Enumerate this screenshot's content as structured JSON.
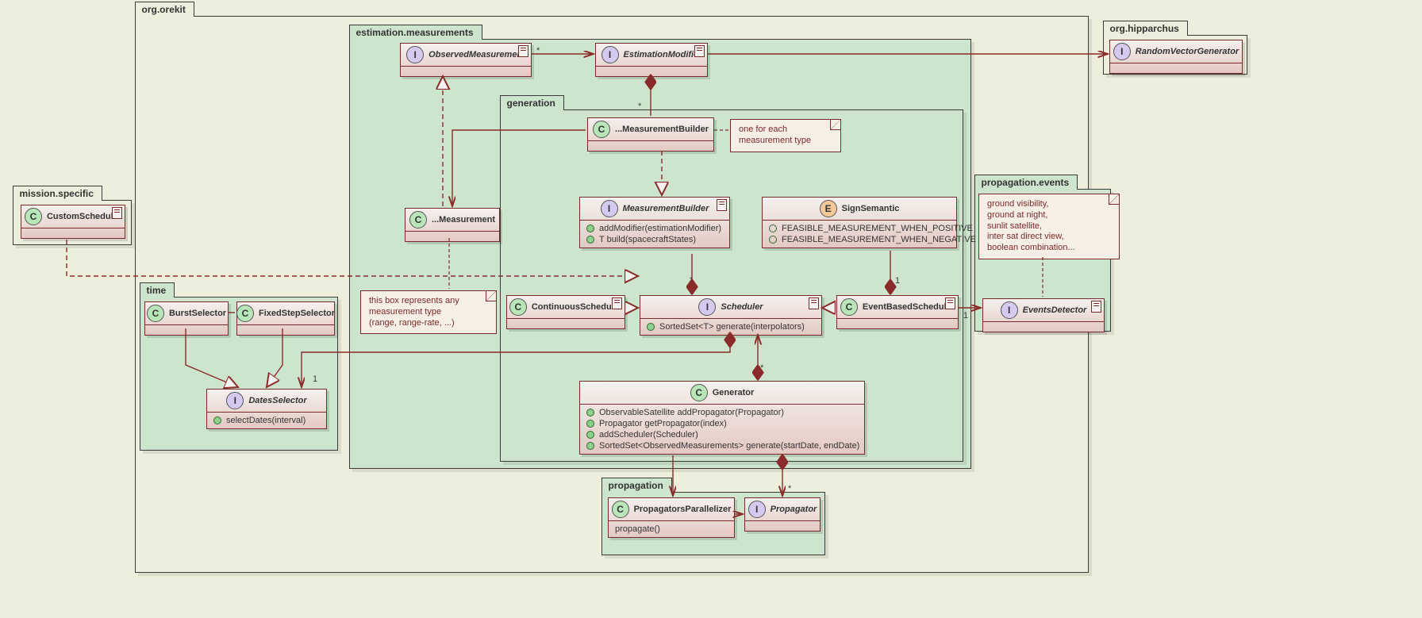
{
  "packages": {
    "mission_specific": "mission.specific",
    "org_orekit": "org.orekit",
    "time": "time",
    "estimation_measurements": "estimation.measurements",
    "generation": "generation",
    "propagation": "propagation",
    "propagation_events": "propagation.events",
    "org_hipparchus": "org.hipparchus"
  },
  "classes": {
    "custom_scheduler": "CustomScheduler",
    "burst_selector": "BurstSelector",
    "fixed_step_selector": "FixedStepSelector",
    "dates_selector": "DatesSelector",
    "dates_selector_m1": "selectDates(interval)",
    "observed_measurement": "ObservedMeasurement",
    "estimation_modifier": "EstimationModifier",
    "measurement": "...Measurement",
    "measurement_builder_cls": "...MeasurementBuilder",
    "measurement_builder_iface": "MeasurementBuilder",
    "mb_m1": "addModifier(estimationModifier)",
    "mb_m2": "T build(spacecraftStates)",
    "sign_semantic": "SignSemantic",
    "ss_m1": "FEASIBLE_MEASUREMENT_WHEN_POSITIVE",
    "ss_m2": "FEASIBLE_MEASUREMENT_WHEN_NEGATIVE",
    "continuous_scheduler": "ContinuousScheduler",
    "scheduler": "Scheduler",
    "scheduler_m1": "SortedSet<T> generate(interpolators)",
    "event_based_scheduler": "EventBasedScheduler",
    "generator": "Generator",
    "gen_m1": "ObservableSatellite addPropagator(Propagator)",
    "gen_m2": "Propagator getPropagator(index)",
    "gen_m3": "addScheduler(Scheduler)",
    "gen_m4": "SortedSet<ObservedMeasurements> generate(startDate, endDate)",
    "propagators_parallelizer": "PropagatorsParallelizer",
    "pp_m1": "propagate()",
    "propagator": "Propagator",
    "events_detector": "EventsDetector",
    "random_vector_generator": "RandomVectorGenerator"
  },
  "notes": {
    "measurement_note_l1": "this box represents any",
    "measurement_note_l2": "measurement type",
    "measurement_note_l3": "(range, range-rate, ...)",
    "mb_note_l1": "one for each",
    "mb_note_l2": "measurement type",
    "events_note_l1": "ground visibility,",
    "events_note_l2": "ground at night,",
    "events_note_l3": "sunlit satellite,",
    "events_note_l4": "inter sat direct view,",
    "events_note_l5": "boolean combination..."
  },
  "multiplicities": {
    "star": "*",
    "one": "1"
  }
}
